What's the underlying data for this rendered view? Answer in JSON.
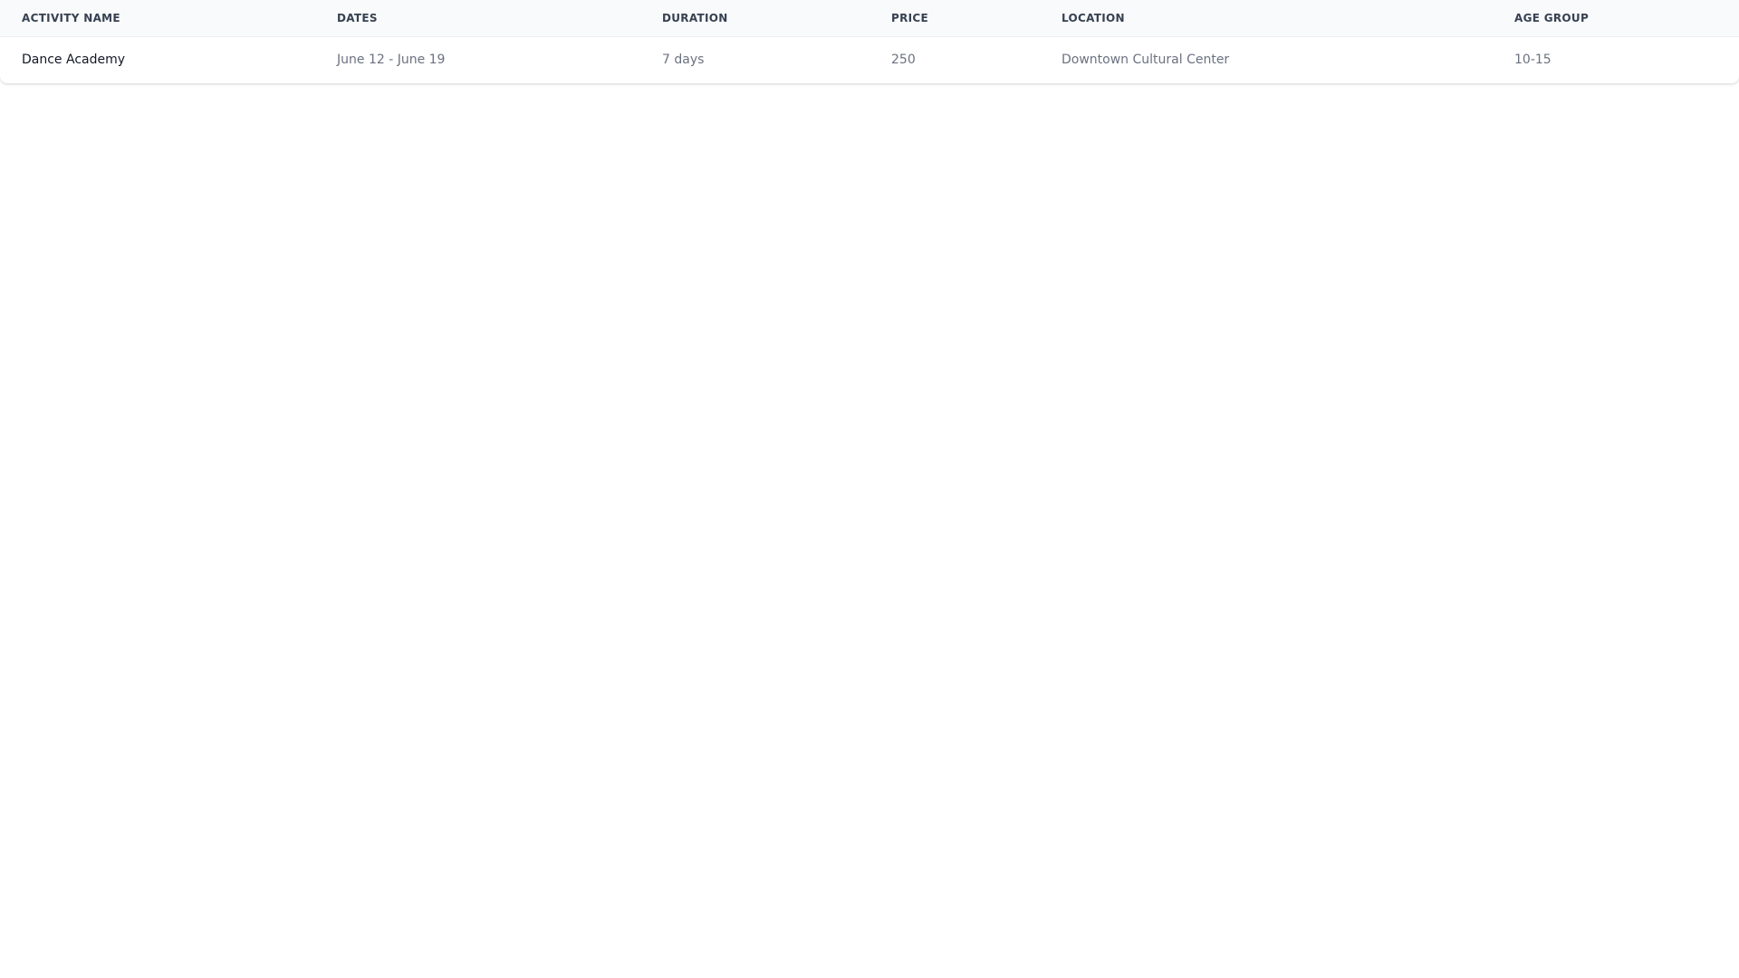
{
  "table": {
    "headers": {
      "activity_name": "ACTIVITY NAME",
      "dates": "DATES",
      "duration": "DURATION",
      "price": "PRICE",
      "location": "LOCATION",
      "age_group": "AGE GROUP"
    },
    "rows": [
      {
        "activity_name": "Dance Academy",
        "dates": "June 12 - June 19",
        "duration": "7 days",
        "price": "250",
        "location": "Downtown Cultural Center",
        "age_group": "10-15"
      }
    ]
  }
}
